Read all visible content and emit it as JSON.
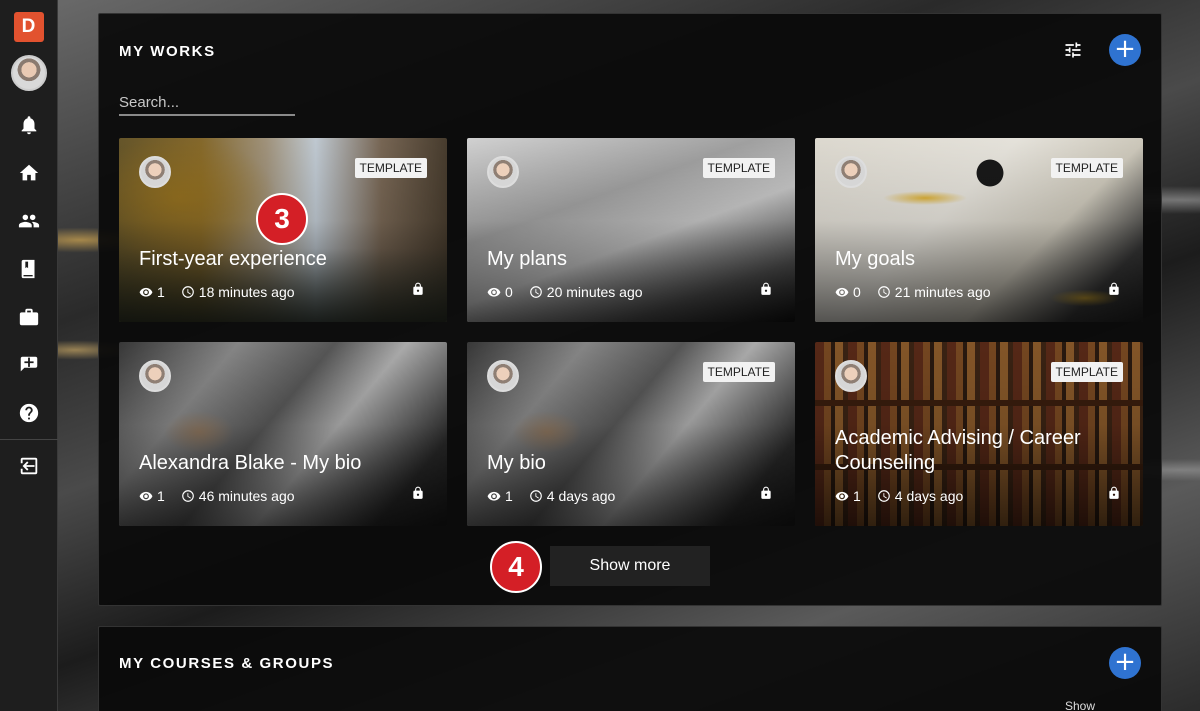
{
  "sidebar": {
    "logo": "D",
    "icons": [
      "bell-icon",
      "home-icon",
      "people-icon",
      "book-icon",
      "briefcase-icon",
      "add-note-icon",
      "help-icon",
      "logout-icon"
    ]
  },
  "works": {
    "title": "MY WORKS",
    "add_label": "+",
    "search_placeholder": "Search...",
    "show_more": "Show more",
    "badge_template": "TEMPLATE",
    "cards": [
      {
        "title": "First-year experience",
        "views": "1",
        "time": "18 minutes ago",
        "template": true
      },
      {
        "title": "My plans",
        "views": "0",
        "time": "20 minutes ago",
        "template": true
      },
      {
        "title": "My goals",
        "views": "0",
        "time": "21 minutes ago",
        "template": true
      },
      {
        "title": "Alexandra Blake - My bio",
        "views": "1",
        "time": "46 minutes ago",
        "template": false
      },
      {
        "title": "My bio",
        "views": "1",
        "time": "4 days ago",
        "template": true
      },
      {
        "title": "Academic Advising / Career Counseling",
        "views": "1",
        "time": "4 days ago",
        "template": true
      }
    ]
  },
  "steps": {
    "step3": "3",
    "step4": "4"
  },
  "courses": {
    "title": "MY COURSES & GROUPS",
    "add_label": "+",
    "show_label": "Show"
  },
  "colors": {
    "accent": "#2f73d1",
    "step": "#d41f26",
    "logo": "#e2522f"
  }
}
